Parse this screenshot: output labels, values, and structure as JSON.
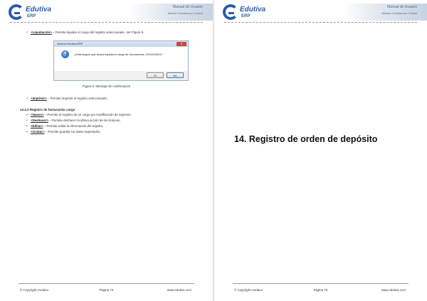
{
  "header": {
    "logo_name": "Edutiva",
    "logo_sub": "ERP",
    "manual_title": "Manual de Usuario",
    "module_title": "Módulo Cuentas por Cobrar"
  },
  "left_page": {
    "item_liquidacion": {
      "keyword": "<Liquidación>",
      "text": " – Permite liquidar el cargo del registro seleccionado. Ver Figura 5."
    },
    "dialog": {
      "title": "Sistema Edutiva ERP",
      "close_label": "✕",
      "message": "¿Está seguro que desea liquidar el cargo de documentos: 2011000001?",
      "yes_label": "Sí",
      "no_label": "No"
    },
    "caption": "Figura 5. Mensaje de confirmación",
    "item_imprimir": {
      "keyword": "<Imprimir>",
      "text": " – Permite imprimir el registro seleccionado."
    },
    "subheading": "13.4.2 Registro de facturación cargo",
    "items": [
      {
        "keyword": "<Nuevo>",
        "text": " – Permite el registro de un cargo por modificación de ingresos."
      },
      {
        "keyword": "<Deshacer>",
        "text": " – Permite deshacer la última acción de los botones."
      },
      {
        "keyword": "<Editar>",
        "text": " – Permite editar la información del registro."
      },
      {
        "keyword": "<Grabar>",
        "text": " – Permite guardar los datos ingresados."
      }
    ],
    "footer": {
      "copyright": "© Copyright Avelano",
      "page": "Página 74",
      "site": "www.edutiva.com"
    }
  },
  "right_page": {
    "chapter_title": "14. Registro de orden de depósito",
    "footer": {
      "copyright": "© Copyright Avelano",
      "page": "Página 75",
      "site": "www.edutiva.com"
    }
  },
  "colors": {
    "brand": "#2a5da8",
    "page": "#ffffff",
    "close": "#c8463c"
  }
}
